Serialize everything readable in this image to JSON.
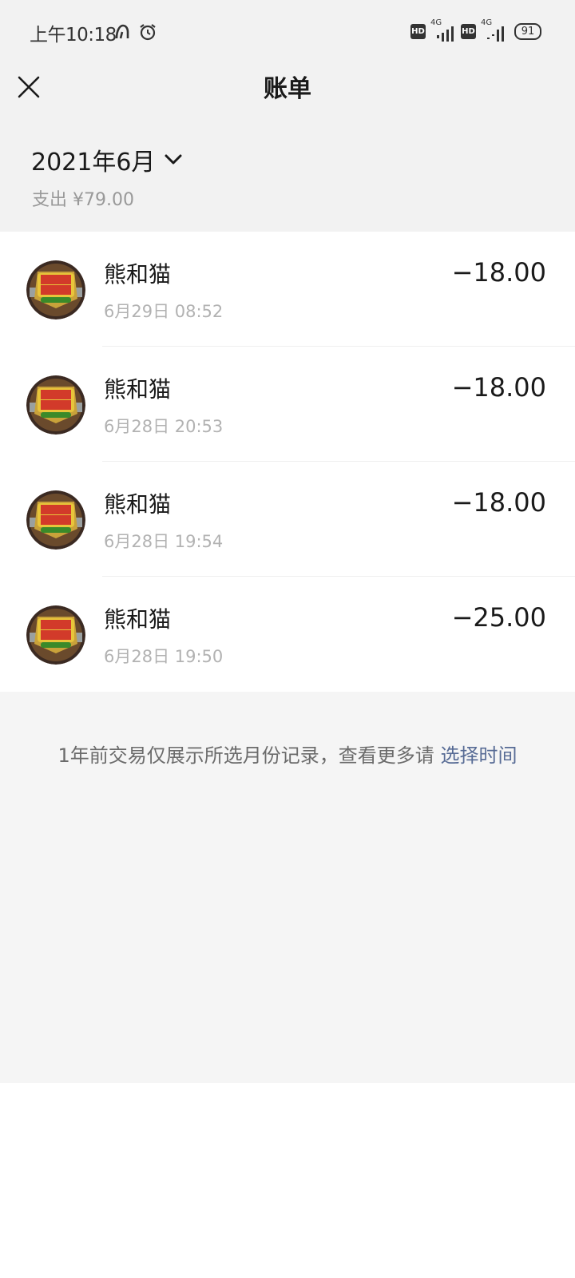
{
  "status_bar": {
    "time": "上午10:18",
    "battery": "91",
    "network_label": "4G",
    "hd_label": "HD"
  },
  "header": {
    "title": "账单",
    "close_icon": "close-icon"
  },
  "month": {
    "label": "2021年6月",
    "summary": "支出 ¥79.00"
  },
  "transactions": [
    {
      "merchant": "熊和猫",
      "time": "6月29日 08:52",
      "amount": "−18.00"
    },
    {
      "merchant": "熊和猫",
      "time": "6月28日 20:53",
      "amount": "−18.00"
    },
    {
      "merchant": "熊和猫",
      "time": "6月28日 19:54",
      "amount": "−18.00"
    },
    {
      "merchant": "熊和猫",
      "time": "6月28日 19:50",
      "amount": "−25.00"
    }
  ],
  "footer": {
    "note": "1年前交易仅展示所选月份记录，查看更多请",
    "link": "选择时间"
  },
  "colors": {
    "link": "#576b95",
    "gray_bg": "#f2f2f2"
  }
}
